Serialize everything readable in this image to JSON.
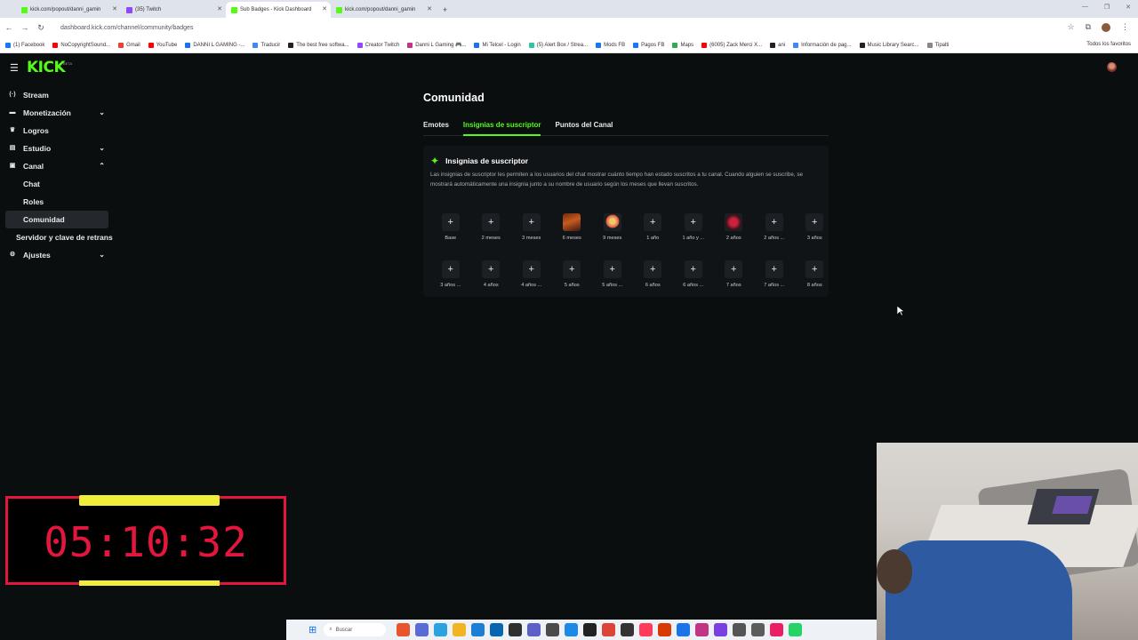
{
  "browser": {
    "tabs": [
      {
        "title": "kick.com/popout/danni_gamin",
        "color": "#53fc18",
        "active": false
      },
      {
        "title": "(35) Twitch",
        "color": "#9146ff",
        "active": false
      },
      {
        "title": "Sub Badges - Kick Dashboard",
        "color": "#53fc18",
        "active": true
      },
      {
        "title": "kick.com/popout/danni_gamin",
        "color": "#53fc18",
        "active": false
      }
    ],
    "url": "dashboard.kick.com/channel/community/badges",
    "bookmarks": [
      {
        "label": "(1) Facebook",
        "color": "#1877f2"
      },
      {
        "label": "NoCopyrightSound...",
        "color": "#ff0000"
      },
      {
        "label": "Gmail",
        "color": "#ea4335"
      },
      {
        "label": "YouTube",
        "color": "#ff0000"
      },
      {
        "label": "DANNI L GAMING -...",
        "color": "#1a73e8"
      },
      {
        "label": "Traducir",
        "color": "#4285f4"
      },
      {
        "label": "The best free softwa...",
        "color": "#222222"
      },
      {
        "label": "Creator Twitch",
        "color": "#9146ff"
      },
      {
        "label": "Danni L Gaming 🎮...",
        "color": "#c13584"
      },
      {
        "label": "Mi Telcel - Login",
        "color": "#1a73e8"
      },
      {
        "label": "(5) Alert Box / Strea...",
        "color": "#31c3a2"
      },
      {
        "label": "Mods FB",
        "color": "#1877f2"
      },
      {
        "label": "Pagos FB",
        "color": "#1877f2"
      },
      {
        "label": "Maps",
        "color": "#34a853"
      },
      {
        "label": "(6005) Zack Merci X...",
        "color": "#ff0000"
      },
      {
        "label": "ani",
        "color": "#222222"
      },
      {
        "label": "Información de pag...",
        "color": "#4285f4"
      },
      {
        "label": "Music Library Searc...",
        "color": "#222222"
      },
      {
        "label": "Tipalti",
        "color": "#888888"
      }
    ],
    "bookmarks_all": "Todos los favoritos"
  },
  "app": {
    "logo": "KICK",
    "beta": "BETA",
    "sidebar": [
      {
        "label": "Stream",
        "icon": "stream-icon",
        "chevron": ""
      },
      {
        "label": "Monetización",
        "icon": "monetization-icon",
        "chevron": "⌄"
      },
      {
        "label": "Logros",
        "icon": "trophy-icon",
        "chevron": ""
      },
      {
        "label": "Estudio",
        "icon": "studio-icon",
        "chevron": "⌄"
      },
      {
        "label": "Canal",
        "icon": "channel-icon",
        "chevron": "⌃"
      }
    ],
    "sidebar_sub": [
      "Chat",
      "Roles",
      "Comunidad"
    ],
    "sidebar_more": "Servidor y clave de retrans",
    "sidebar_settings": "Ajustes",
    "page_title": "Comunidad",
    "tabs": [
      "Emotes",
      "Insignias de suscriptor",
      "Puntos del Canal"
    ],
    "card": {
      "title": "Insignias de suscriptor",
      "description": "Las insignias de suscriptor les permiten a los usuarios del chat mostrar cuánto tiempo han estado suscritos a tu canal. Cuando alguien se suscribe, se mostrará automáticamente una insignia junto a su nombre de usuario según los meses que llevan suscritos."
    },
    "badges": [
      {
        "label": "Base",
        "image": ""
      },
      {
        "label": "2 meses",
        "image": ""
      },
      {
        "label": "3 meses",
        "image": ""
      },
      {
        "label": "6 meses",
        "image": "img1"
      },
      {
        "label": "9 meses",
        "image": "img2"
      },
      {
        "label": "1 año",
        "image": ""
      },
      {
        "label": "1 año y ...",
        "image": ""
      },
      {
        "label": "2 años",
        "image": "img3"
      },
      {
        "label": "2 años ...",
        "image": ""
      },
      {
        "label": "3 años",
        "image": ""
      },
      {
        "label": "3 años ...",
        "image": ""
      },
      {
        "label": "4 años",
        "image": ""
      },
      {
        "label": "4 años ...",
        "image": ""
      },
      {
        "label": "5 años",
        "image": ""
      },
      {
        "label": "5 años ...",
        "image": ""
      },
      {
        "label": "6 años",
        "image": ""
      },
      {
        "label": "6 años ...",
        "image": ""
      },
      {
        "label": "7 años",
        "image": ""
      },
      {
        "label": "7 años ...",
        "image": ""
      },
      {
        "label": "8 años",
        "image": ""
      }
    ]
  },
  "overlay": {
    "timer": "05:10:32",
    "taskbar_search": "Buscar"
  }
}
